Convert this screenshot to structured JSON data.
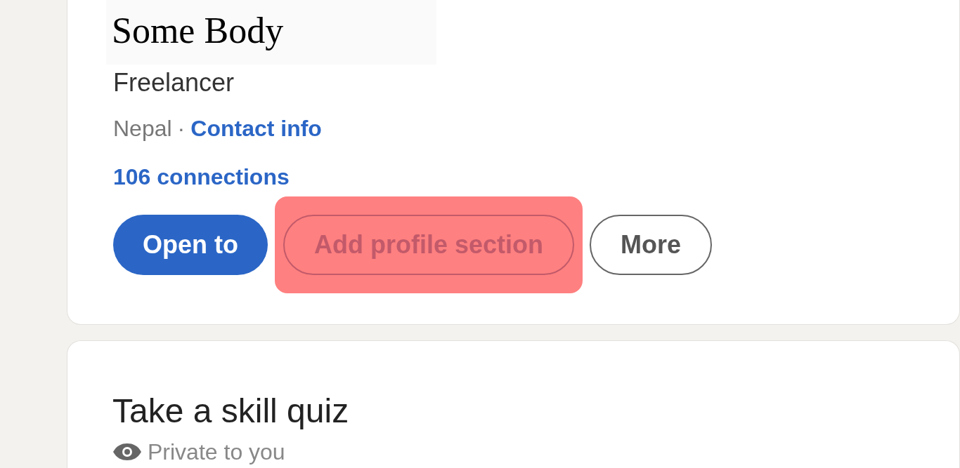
{
  "profile": {
    "name": "Some Body",
    "headline": "Freelancer",
    "location": "Nepal",
    "separator": "·",
    "contact_link": "Contact info",
    "connections": "106 connections",
    "buttons": [
      {
        "label": "Open to",
        "kind": "primary",
        "highlighted": false
      },
      {
        "label": "Add profile section",
        "kind": "outline",
        "highlighted": true
      },
      {
        "label": "More",
        "kind": "outline",
        "highlighted": false
      }
    ]
  },
  "quiz_card": {
    "title": "Take a skill quiz",
    "visibility": "Private to you"
  }
}
